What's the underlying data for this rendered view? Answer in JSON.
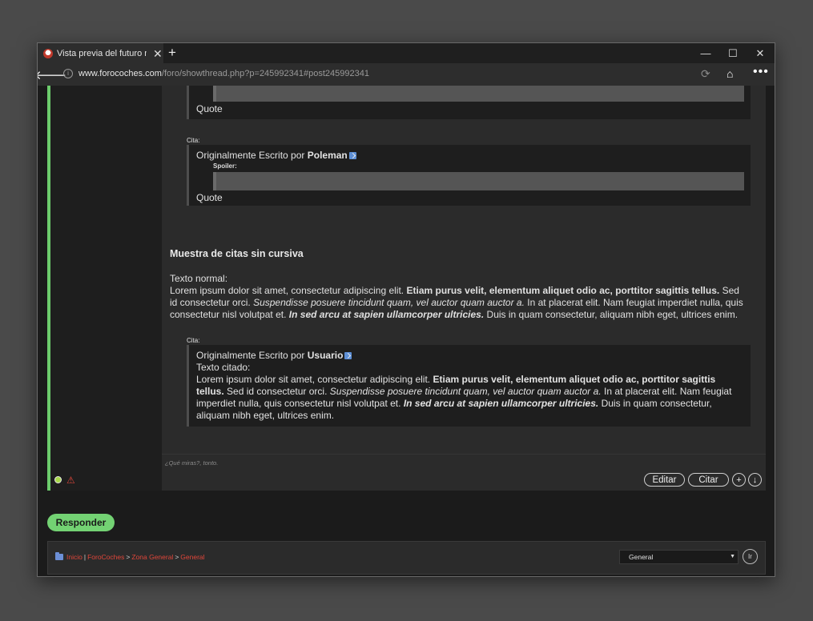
{
  "browser": {
    "tab_title": "Vista previa del futuro mo...",
    "url_host": "www.forocoches.com",
    "url_path": "/foro/showthread.php?p=245992341#post245992341"
  },
  "post": {
    "quote_top_last_line": "Quote",
    "quote2": {
      "cita_label": "Cita:",
      "prefix": "Originalmente Escrito por",
      "author": "Poleman",
      "spoiler_label": "Spoiler:",
      "last_line": "Quote"
    },
    "section_title": "Muestra de citas sin cursiva",
    "plain": {
      "heading": "Texto normal:",
      "p1": "Lorem ipsum dolor sit amet, consectetur adipiscing elit.",
      "p2_bold": "Etiam purus velit, elementum aliquet odio ac, porttitor sagittis tellus.",
      "p3": "Sed id consectetur orci.",
      "p4_italic": "Suspendisse posuere tincidunt quam, vel auctor quam auctor a.",
      "p5": "In at placerat elit. Nam feugiat imperdiet nulla, quis consectetur nisl volutpat et.",
      "p6_bolditalic": "In sed arcu at sapien ullamcorper ultricies.",
      "p7": "Duis in quam consectetur, aliquam nibh eget, ultrices enim."
    },
    "quote3": {
      "cita_label": "Cita:",
      "prefix": "Originalmente Escrito por",
      "author": "Usuario",
      "heading": "Texto citado:"
    },
    "signature": "¿Qué miras?, tonto.",
    "edit_label": "Editar",
    "quote_label": "Citar",
    "plus_label": "+",
    "down_label": "↓"
  },
  "reply_label": "Responder",
  "navbar": {
    "crumbs": [
      "Inicio",
      "ForoCoches",
      "Zona General",
      "General"
    ],
    "sep_pipe": "|",
    "sep_gt": ">",
    "select_value": "General",
    "go_label": "Ir"
  }
}
